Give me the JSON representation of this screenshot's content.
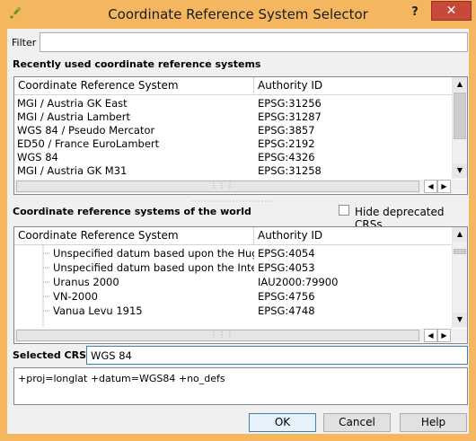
{
  "window": {
    "title": "Coordinate Reference System Selector",
    "help_glyph": "?",
    "close_glyph": "✕"
  },
  "filter": {
    "label": "Filter",
    "value": ""
  },
  "recent": {
    "heading": "Recently used coordinate reference systems",
    "col_crs": "Coordinate Reference System",
    "col_auth": "Authority ID",
    "rows": [
      {
        "name": "MGI / Austria GK East",
        "auth": "EPSG:31256"
      },
      {
        "name": "MGI / Austria Lambert",
        "auth": "EPSG:31287"
      },
      {
        "name": "WGS 84 / Pseudo Mercator",
        "auth": "EPSG:3857"
      },
      {
        "name": "ED50 / France EuroLambert",
        "auth": "EPSG:2192"
      },
      {
        "name": "WGS 84",
        "auth": "EPSG:4326"
      },
      {
        "name": "MGI / Austria GK M31",
        "auth": "EPSG:31258"
      }
    ]
  },
  "world": {
    "heading": "Coordinate reference systems of the world",
    "hide_deprecated_label": "Hide deprecated CRSs",
    "hide_deprecated_checked": false,
    "col_crs": "Coordinate Reference System",
    "col_auth": "Authority ID",
    "rows": [
      {
        "name": "Unspecified datum based upon the Hug...",
        "auth": "EPSG:4054"
      },
      {
        "name": "Unspecified datum based upon the Inter...",
        "auth": "EPSG:4053"
      },
      {
        "name": "Uranus 2000",
        "auth": "IAU2000:79900"
      },
      {
        "name": "VN-2000",
        "auth": "EPSG:4756"
      },
      {
        "name": "Vanua Levu 1915",
        "auth": "EPSG:4748"
      }
    ]
  },
  "selected": {
    "label": "Selected CRS:",
    "value": "WGS 84"
  },
  "proj_string": "+proj=longlat +datum=WGS84 +no_defs",
  "buttons": {
    "ok": "OK",
    "cancel": "Cancel",
    "help": "Help"
  },
  "colors": {
    "frame": "#f4b760",
    "close": "#c7493a",
    "selection_focus": "#3c7fb1"
  }
}
